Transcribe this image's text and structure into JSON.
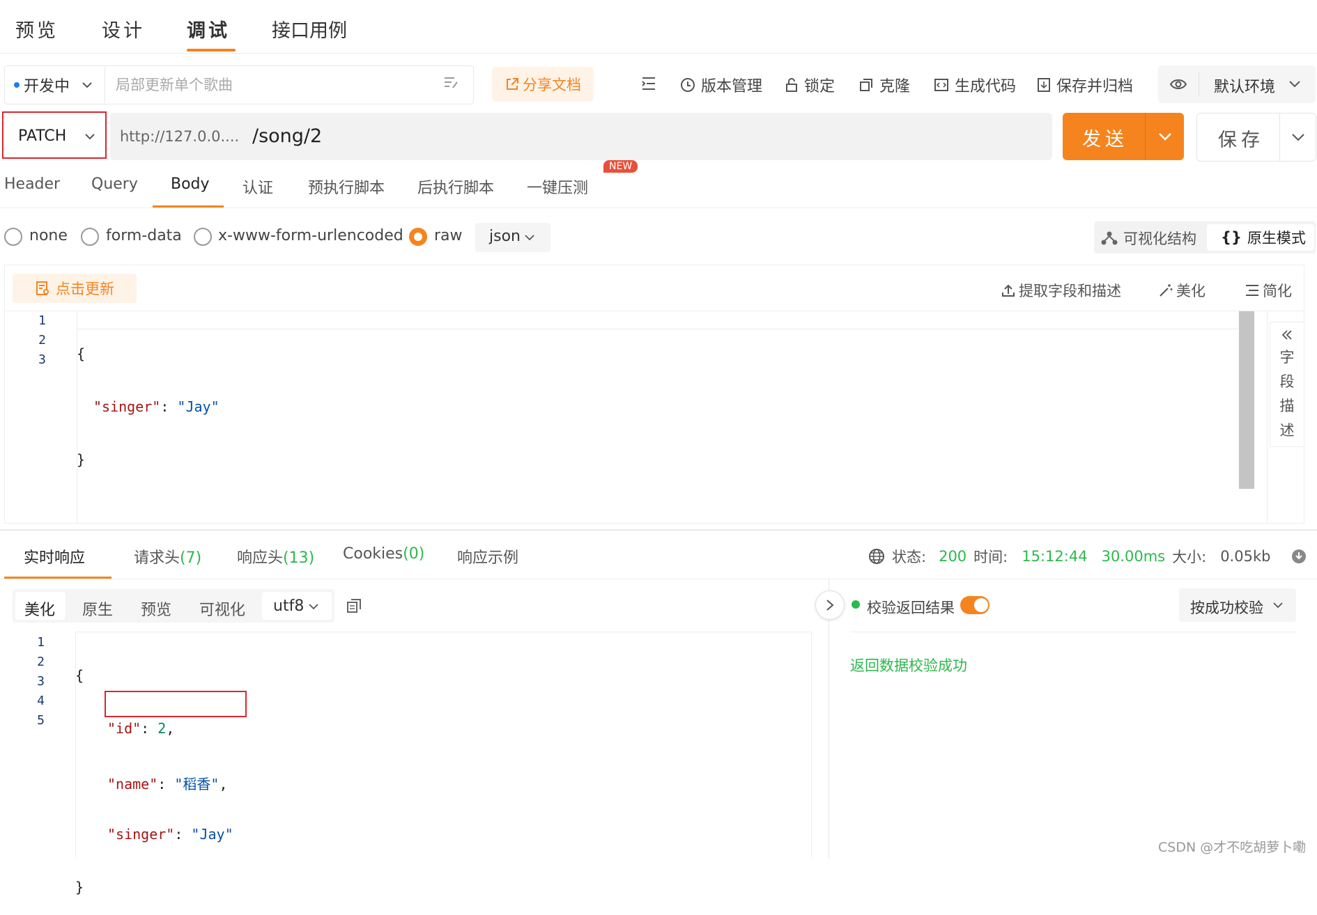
{
  "top_tabs": [
    {
      "label": "预览"
    },
    {
      "label": "设计"
    },
    {
      "label": "调试"
    },
    {
      "label": "接口用例"
    }
  ],
  "api": {
    "status_label": "开发中",
    "name_placeholder": "局部更新单个歌曲",
    "share_label": "分享文档"
  },
  "toolbar": {
    "version_label": "版本管理",
    "lock_label": "锁定",
    "clone_label": "克隆",
    "gen_code_label": "生成代码",
    "save_archive_label": "保存并归档",
    "env_label": "默认环境"
  },
  "request": {
    "method": "PATCH",
    "base_url": "http://127.0.0....",
    "path": "/song/2",
    "send_label": "发送",
    "save_label": "保存"
  },
  "req_tabs": [
    {
      "label": "Header"
    },
    {
      "label": "Query"
    },
    {
      "label": "Body"
    },
    {
      "label": "认证"
    },
    {
      "label": "预执行脚本"
    },
    {
      "label": "后执行脚本"
    },
    {
      "label": "一键压测"
    }
  ],
  "new_badge": "NEW",
  "body_types": {
    "none": "none",
    "form_data": "form-data",
    "urlencoded": "x-www-form-urlencoded",
    "raw": "raw",
    "format": "json"
  },
  "view_modes": {
    "visual": "可视化结构",
    "raw": "原生模式",
    "raw_glyph": "{}"
  },
  "editor_toolbar": {
    "update_label": "点击更新",
    "extract_label": "提取字段和描述",
    "beautify_label": "美化",
    "simplify_label": "简化"
  },
  "request_body": {
    "line_numbers": [
      "1",
      "2",
      "3"
    ],
    "open": "{",
    "key": "\"singer\"",
    "sep": ": ",
    "value": "\"Jay\"",
    "close": "}"
  },
  "field_desc": {
    "chars": [
      "字",
      "段",
      "描",
      "述"
    ]
  },
  "response_tabs": {
    "realtime": "实时响应",
    "req_headers": "请求头",
    "req_headers_count": "(7)",
    "resp_headers": "响应头",
    "resp_headers_count": "(13)",
    "cookies": "Cookies",
    "cookies_count": "(0)",
    "examples": "响应示例"
  },
  "status": {
    "status_label": "状态:",
    "status_code": "200",
    "time_label": "时间:",
    "time_value": "15:12:44",
    "duration": "30.00ms",
    "size_label": "大小:",
    "size_value": "0.05kb"
  },
  "response_format": {
    "beautify": "美化",
    "raw": "原生",
    "preview": "预览",
    "visual": "可视化",
    "encoding": "utf8"
  },
  "response_body": {
    "line_numbers": [
      "1",
      "2",
      "3",
      "4",
      "5"
    ],
    "open": "{",
    "id_key": "\"id\"",
    "id_value": "2",
    "name_key": "\"name\"",
    "name_value": "\"稻香\"",
    "singer_key": "\"singer\"",
    "singer_value": "\"Jay\"",
    "sep": ": ",
    "comma": ",",
    "close": "}"
  },
  "validation": {
    "label": "校验返回结果",
    "enabled": true,
    "mode": "按成功校验",
    "result": "返回数据校验成功"
  },
  "watermark": "CSDN @才不吃胡萝卜嘞",
  "colors": {
    "accent": "#f5841f",
    "success": "#2db84d",
    "highlight_box": "#d9272e"
  }
}
